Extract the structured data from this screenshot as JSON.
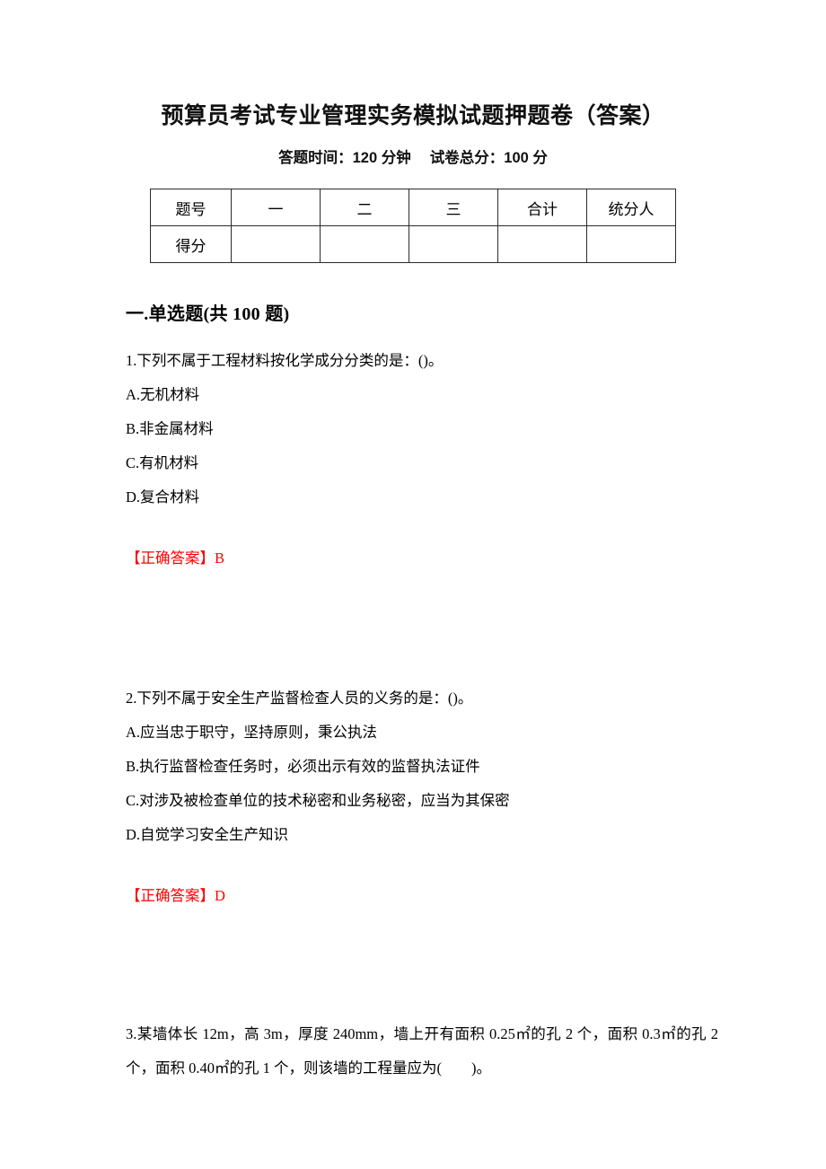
{
  "document": {
    "title": "预算员考试专业管理实务模拟试题押题卷（答案）",
    "subtitle": "答题时间：120 分钟　 试卷总分：100 分",
    "answer_color": "#ff0000"
  },
  "score_table": {
    "header_row": [
      "题号",
      "一",
      "二",
      "三",
      "合计",
      "统分人"
    ],
    "score_row": [
      "得分",
      "",
      "",
      "",
      "",
      ""
    ]
  },
  "sections": [
    {
      "heading": "一.单选题(共 100 题)"
    }
  ],
  "questions": [
    {
      "stem": "1.下列不属于工程材料按化学成分分类的是：()。",
      "options": [
        "A.无机材料",
        "B.非金属材料",
        "C.有机材料",
        "D.复合材料"
      ],
      "answer_label": "【正确答案】",
      "answer_value": "B"
    },
    {
      "stem": "2.下列不属于安全生产监督检查人员的义务的是：()。",
      "options": [
        "A.应当忠于职守，坚持原则，秉公执法",
        "B.执行监督检查任务时，必须出示有效的监督执法证件",
        "C.对涉及被检查单位的技术秘密和业务秘密，应当为其保密",
        "D.自觉学习安全生产知识"
      ],
      "answer_label": "【正确答案】",
      "answer_value": "D"
    },
    {
      "stem": "3.某墙体长 12m，高 3m，厚度 240mm，墙上开有面积 0.25㎡的孔 2 个，面积 0.3㎡的孔 2 个，面积 0.40㎡的孔 1 个，则该墙的工程量应为(　　)。",
      "options": [],
      "answer_label": "",
      "answer_value": ""
    }
  ]
}
